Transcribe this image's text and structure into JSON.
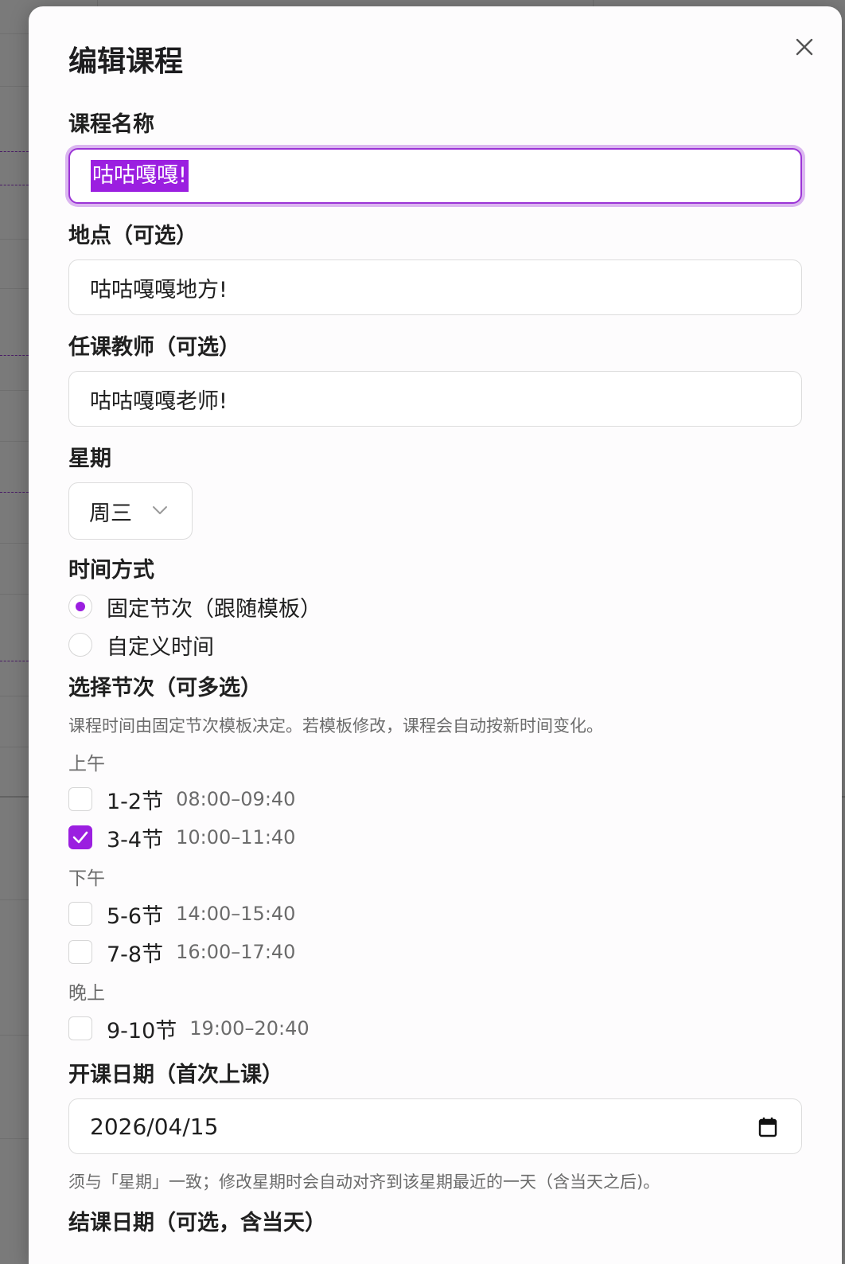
{
  "dialog": {
    "title": "编辑课程",
    "close_icon": "close-icon"
  },
  "course_name": {
    "label": "课程名称",
    "value": "咕咕嘎嘎!"
  },
  "location": {
    "label": "地点（可选）",
    "value": "咕咕嘎嘎地方!"
  },
  "teacher": {
    "label": "任课教师（可选）",
    "value": "咕咕嘎嘎老师!"
  },
  "weekday": {
    "label": "星期",
    "value": "周三",
    "icon": "chevron-down-icon"
  },
  "time_mode": {
    "label": "时间方式",
    "options": [
      {
        "label": "固定节次（跟随模板）",
        "selected": true
      },
      {
        "label": "自定义时间",
        "selected": false
      }
    ]
  },
  "periods": {
    "label": "选择节次（可多选）",
    "hint": "课程时间由固定节次模板决定。若模板修改，课程会自动按新时间变化。",
    "groups": [
      {
        "name": "上午",
        "items": [
          {
            "label": "1-2节",
            "time": "08:00–09:40",
            "checked": false
          },
          {
            "label": "3-4节",
            "time": "10:00–11:40",
            "checked": true
          }
        ]
      },
      {
        "name": "下午",
        "items": [
          {
            "label": "5-6节",
            "time": "14:00–15:40",
            "checked": false
          },
          {
            "label": "7-8节",
            "time": "16:00–17:40",
            "checked": false
          }
        ]
      },
      {
        "name": "晚上",
        "items": [
          {
            "label": "9-10节",
            "time": "19:00–20:40",
            "checked": false
          }
        ]
      }
    ]
  },
  "start_date": {
    "label": "开课日期（首次上课）",
    "value": "2026/04/15",
    "icon": "calendar-icon",
    "hint": "须与「星期」一致；修改星期时会自动对齐到该星期最近的一天（含当天之后)。"
  },
  "end_date": {
    "label": "结课日期（可选，含当天）"
  },
  "colors": {
    "accent": "#9b1fe0",
    "focus_ring": "#9b34d6"
  }
}
